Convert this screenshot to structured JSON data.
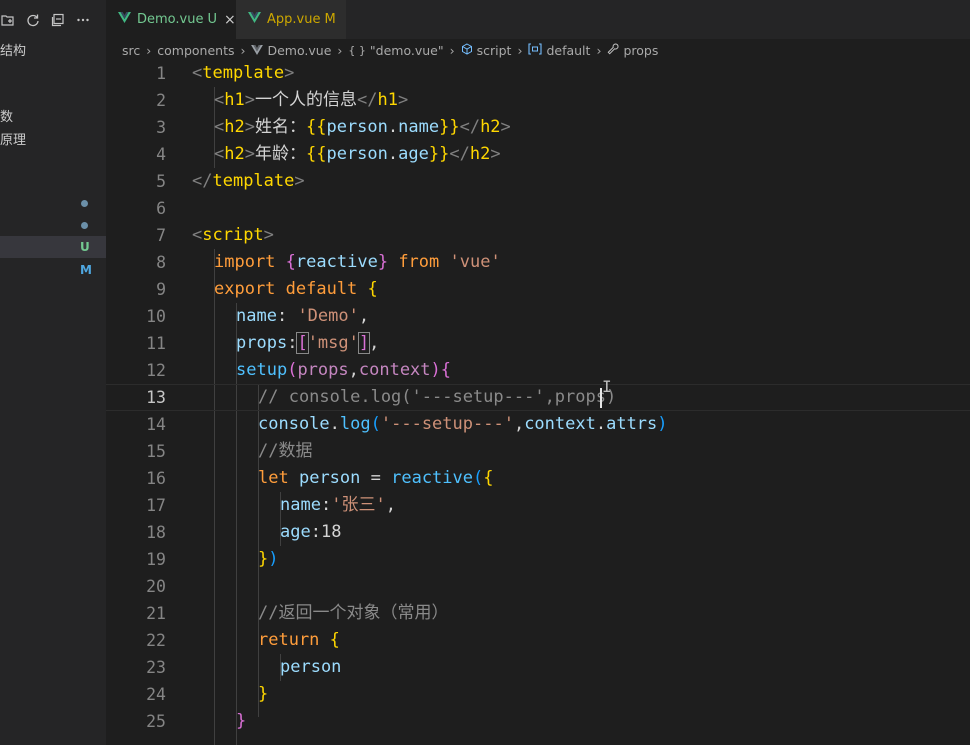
{
  "sidebar": {
    "partial_labels": [
      "结构",
      "数",
      "原理"
    ],
    "badges": [
      "U",
      "M"
    ],
    "badge_colors": {
      "U": "#73c991",
      "M": "#4fa7e0"
    }
  },
  "tabs": [
    {
      "label": "Demo.vue",
      "status": "U",
      "active": true,
      "close": "×"
    },
    {
      "label": "App.vue",
      "status": "M",
      "active": false
    }
  ],
  "breadcrumb": {
    "items": [
      "src",
      "components",
      "Demo.vue",
      "\"demo.vue\"",
      "script",
      "default",
      "props"
    ],
    "icons": [
      "folder",
      "folder",
      "vue-icon",
      "braces-icon",
      "cube-icon",
      "object-icon",
      "wrench-icon"
    ],
    "braces_text": "{ }"
  },
  "editor": {
    "current_line": 13,
    "line_numbers": [
      "1",
      "2",
      "3",
      "4",
      "5",
      "6",
      "7",
      "8",
      "9",
      "10",
      "11",
      "12",
      "13",
      "14",
      "15",
      "16",
      "17",
      "18",
      "19",
      "20",
      "21",
      "22",
      "23",
      "24",
      "25"
    ],
    "lines": [
      "<template>",
      "  <h1>一个人的信息</h1>",
      "  <h2>姓名：{{person.name}}</h2>",
      "  <h2>年龄：{{person.age}}</h2>",
      "</template>",
      "",
      "<script>",
      "  import {reactive} from 'vue'",
      "  export default {",
      "    name: 'Demo',",
      "    props:['msg'],",
      "    setup(props,context){",
      "      // console.log('---setup---',props)",
      "      console.log('---setup---',context.attrs)",
      "      //数据",
      "      let person = reactive({",
      "        name:'张三',",
      "        age:18",
      "      })",
      "",
      "      //返回一个对象（常用）",
      "      return {",
      "        person",
      "      }",
      "    }"
    ]
  }
}
